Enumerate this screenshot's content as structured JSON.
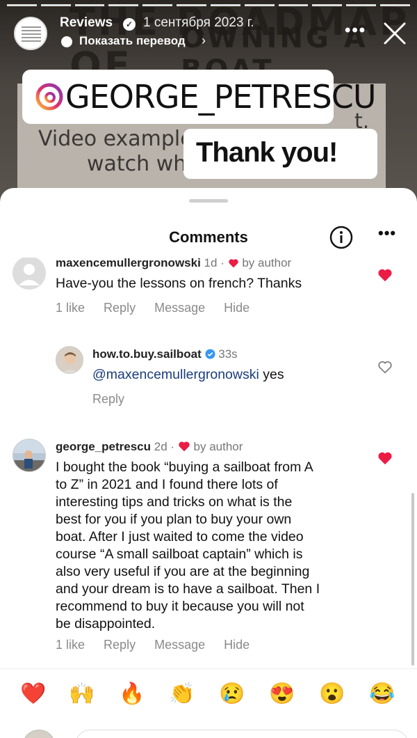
{
  "header": {
    "account_name": "Reviews",
    "date": "1 сентября 2023 г.",
    "translate_label": "Показать перевод",
    "more_glyph": "•••"
  },
  "story": {
    "headline_line1": "THE ROADMAP OF",
    "headline_line2": "OWNING A BOAT",
    "card_line1": "Video examples",
    "card_line2": "watch whe",
    "card_tail": "t."
  },
  "stickers": {
    "mention": "GEORGE_PETRESCU",
    "thanks": "Thank you!"
  },
  "sheet": {
    "title": "Comments",
    "more_glyph": "•••"
  },
  "comments": [
    {
      "username": "maxencemullergronowski",
      "time": "1d",
      "by_author_label": "by author",
      "text": "Have-you the lessons on french? Thanks",
      "actions": {
        "likes": "1 like",
        "reply": "Reply",
        "message": "Message",
        "hide": "Hide"
      },
      "liked": true
    },
    {
      "username": "how.to.buy.sailboat",
      "time": "33s",
      "mention": "@maxencemullergronowski",
      "text": " yes",
      "actions": {
        "reply": "Reply"
      },
      "liked": false
    },
    {
      "username": "george_petrescu",
      "time": "2d",
      "by_author_label": "by author",
      "text_lines": [
        "I bought the book “buying a sailboat from A",
        "to Z” in 2021 and I found there lots of",
        "interesting tips and tricks on what is the",
        "best for you if you plan to buy your own",
        "boat. After I just waited to come the video",
        "course “A small sailboat captain” which is",
        "also very useful if you are at the beginning",
        "and your dream is to have a sailboat. Then I",
        "recommend to buy it because you will not",
        "be disappointed."
      ],
      "actions": {
        "likes": "1 like",
        "reply": "Reply",
        "message": "Message",
        "hide": "Hide"
      },
      "liked": true
    }
  ],
  "reactions": [
    "❤️",
    "🙌",
    "🔥",
    "👏",
    "😢",
    "😍",
    "😮",
    "😂"
  ],
  "colors": {
    "like_red": "#ed1c45",
    "mention_blue": "#1a3d7a",
    "muted": "#8a8a8a"
  }
}
